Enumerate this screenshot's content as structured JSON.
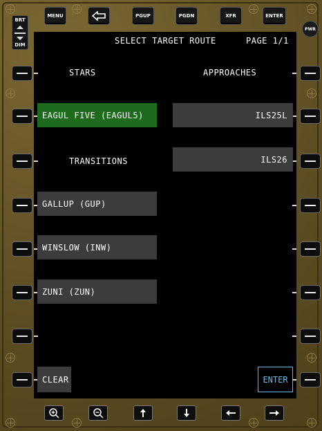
{
  "top_keys": {
    "menu": "MENU",
    "pgup": "PGUP",
    "pgdn": "PGDN",
    "xfr": "XFR",
    "enter": "ENTER"
  },
  "brightness": {
    "up_label": "BRT",
    "down_label": "DIM"
  },
  "power_label": "PWR",
  "screen": {
    "title": "SELECT TARGET ROUTE",
    "page": "PAGE 1/1",
    "stars_header": "STARS",
    "approaches_header": "APPROACHES",
    "transitions_header": "TRANSITIONS",
    "stars": [
      {
        "label": "EAGUL FIVE (EAGUL5)",
        "selected": true
      }
    ],
    "approaches": [
      {
        "label": "ILS25L"
      },
      {
        "label": "ILS26"
      }
    ],
    "transitions": [
      {
        "label": "GALLUP (GUP)"
      },
      {
        "label": "WINSLOW (INW)"
      },
      {
        "label": "ZUNI (ZUN)"
      }
    ],
    "clear_label": "CLEAR",
    "enter_label": "ENTER"
  },
  "colors": {
    "selected": "#1e6b1e",
    "button": "#3c3c3c",
    "enter_outline": "#6fb7e3",
    "bezel": "#6b5a2b"
  },
  "bottom_keys": [
    "zoom-in-icon",
    "zoom-out-icon",
    "arrow-up-icon",
    "arrow-down-icon",
    "arrow-left-icon",
    "arrow-right-icon"
  ]
}
